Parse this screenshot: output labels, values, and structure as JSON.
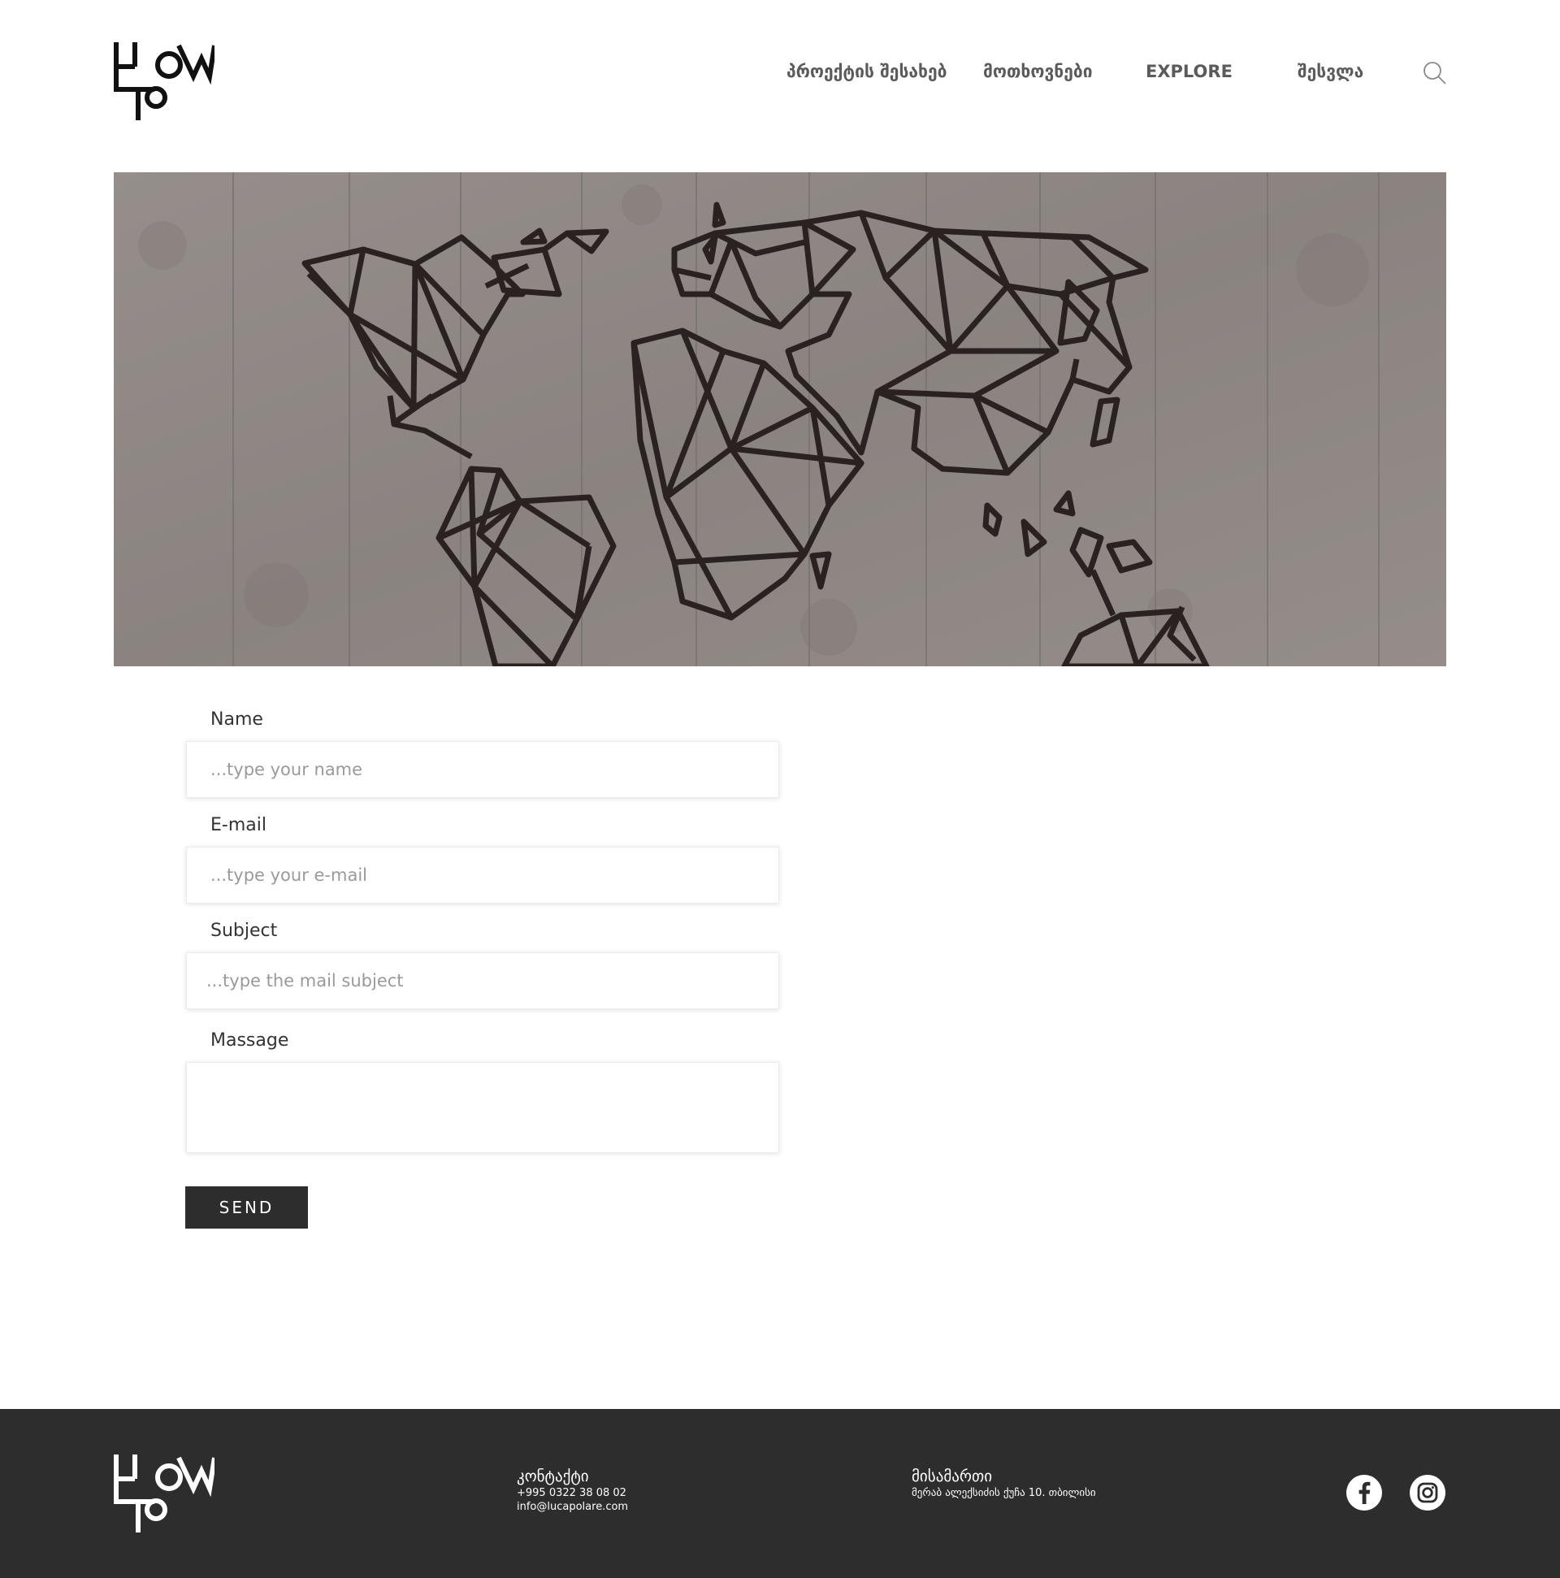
{
  "header": {
    "logo_icon": "how-to-logo",
    "nav": [
      {
        "label": "პროექტის შესახებ"
      },
      {
        "label": "მოთხოვნები"
      },
      {
        "label": "EXPLORE"
      },
      {
        "label": "შესვლა"
      }
    ],
    "search_icon": "search-icon"
  },
  "hero": {
    "image": "geometric-world-map-on-concrete-wall"
  },
  "form": {
    "name": {
      "label": "Name",
      "placeholder": "...type your name",
      "value": ""
    },
    "email": {
      "label": "E-mail",
      "placeholder": "...type your e-mail",
      "value": ""
    },
    "subject": {
      "label": "Subject",
      "placeholder": "...type the mail subject",
      "value": ""
    },
    "message": {
      "label": "Massage",
      "placeholder": "",
      "value": ""
    },
    "send_label": "SEND"
  },
  "footer": {
    "contact": {
      "title": "კონტაქტი",
      "phone": "+995 0322 38 08 02",
      "email": "info@lucapolare.com"
    },
    "address": {
      "title": "მისამართი",
      "line": "მერაბ ალექსიძის ქუჩა 10. თბილისი"
    },
    "social": [
      "facebook-icon",
      "instagram-icon"
    ]
  },
  "colors": {
    "footer_bg": "#2d2d2d",
    "button_bg": "#2d2d2d",
    "nav_text": "#5b5b5b",
    "hero_bg": "#8f8986",
    "map_lines": "#2a2220"
  }
}
